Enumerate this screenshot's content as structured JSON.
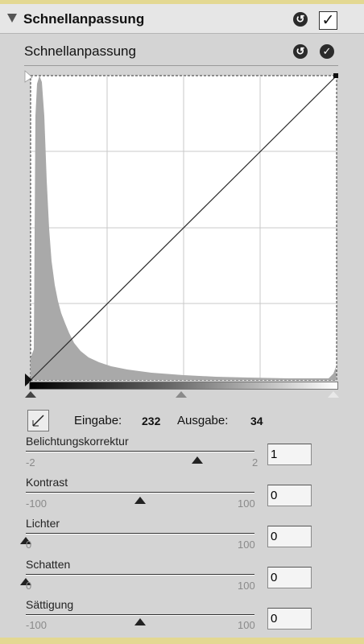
{
  "panel": {
    "title": "Schnellanpassung"
  },
  "quick": {
    "title": "Schnellanpassung"
  },
  "curve": {
    "input_label": "Eingabe:",
    "input_value": "232",
    "output_label": "Ausgabe:",
    "output_value": "34"
  },
  "sliders": [
    {
      "label": "Belichtungskorrektur",
      "min": "-2",
      "max": "2",
      "value": "1",
      "position": 0.75
    },
    {
      "label": "Kontrast",
      "min": "-100",
      "max": "100",
      "value": "0",
      "position": 0.5
    },
    {
      "label": "Lichter",
      "min": "0",
      "max": "100",
      "value": "0",
      "position": 0.0
    },
    {
      "label": "Schatten",
      "min": "0",
      "max": "100",
      "value": "0",
      "position": 0.0
    },
    {
      "label": "Sättigung",
      "min": "-100",
      "max": "100",
      "value": "0",
      "position": 0.5
    }
  ],
  "icons": {
    "reset": "undo-arrow-icon",
    "enabled": "checkmark-icon",
    "collapse": "triangle-down-icon",
    "curve_tool": "curve-tool-icon"
  }
}
